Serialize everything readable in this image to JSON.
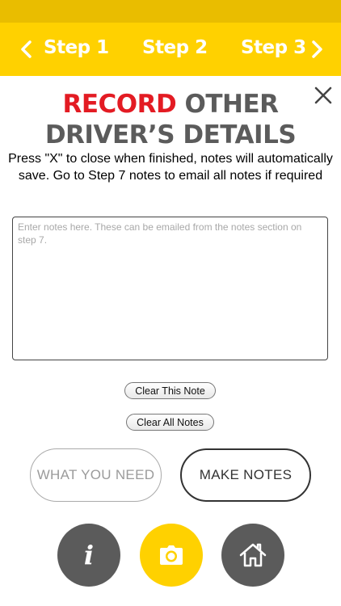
{
  "nav": {
    "steps": [
      "Step 1",
      "Step 2",
      "Step 3"
    ]
  },
  "page": {
    "title_red": "RECORD",
    "title_rest_line1": "OTHER",
    "title_line2": "DRIVER’S DETAILS",
    "instructions": "Press \"X\" to close when finished, notes will automatically save. Go to Step 7 notes to email all notes if required"
  },
  "notes": {
    "value": "",
    "placeholder": "Enter notes here. These can be emailed from the notes section on step 7."
  },
  "buttons": {
    "clear_note": "Clear This Note",
    "clear_all": "Clear All Notes",
    "what_you_need": "WHAT YOU NEED",
    "make_notes": "MAKE NOTES",
    "info_glyph": "i"
  },
  "colors": {
    "brand_yellow": "#ffd100",
    "status_yellow": "#e9bd00",
    "accent_red": "#e31b23",
    "dark_grey": "#5b5b5b"
  },
  "icons": {
    "prev": "chevron-left-icon",
    "next": "chevron-right-icon",
    "close": "close-icon",
    "info": "info-icon",
    "camera": "camera-icon",
    "home": "home-icon"
  }
}
